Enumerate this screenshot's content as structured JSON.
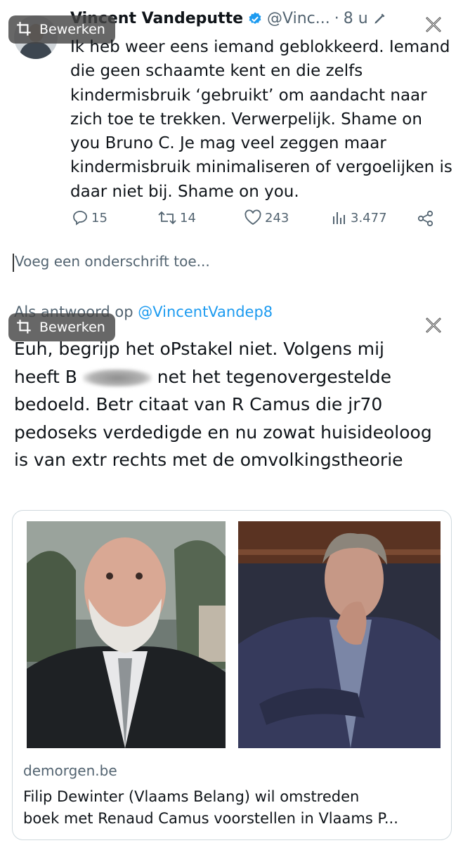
{
  "tweet": {
    "author_name": "Vincent Vandeputte",
    "handle": "@Vinc...",
    "dot": "·",
    "time": "8 u",
    "text": "Ik heb weer eens iemand geblokkeerd. Iemand die geen schaamte kent en die zelfs kindermisbruik ‘gebruikt’ om aandacht naar zich toe te trekken. Verwerpelijk. Shame on you Bruno C. Je mag veel zeggen maar kindermisbruik minimaliseren of vergoelijken is daar niet bij. Shame on you.",
    "replies": "15",
    "retweets": "14",
    "likes": "243",
    "views": "3.477"
  },
  "edit_badge_label": "Bewerken",
  "caption": {
    "placeholder": "Voeg een onderschrift toe..."
  },
  "reply": {
    "prefix": "Als antwoord op",
    "mention": "@VincentVandep8",
    "text_line1": "Euh, begrijp het oPstakel niet. Volgens mij",
    "text_line2_pre": "heeft B",
    "text_line2_post": "net het tegenovergestelde",
    "text_rest": "bedoeld. Betr citaat van R Camus die jr70 pedoseks verdedigde en nu zowat huisideoloog is van extr rechts met de omvolkingstheorie"
  },
  "link_card": {
    "domain": "demorgen.be",
    "title_line1": "Filip Dewinter (Vlaams Belang) wil omstreden",
    "title_line2": "boek met Renaud Camus voorstellen in Vlaams P..."
  },
  "colors": {
    "link_blue": "#1d9bf0",
    "secondary_text": "#536471",
    "verified_blue": "#1d9bf0"
  }
}
